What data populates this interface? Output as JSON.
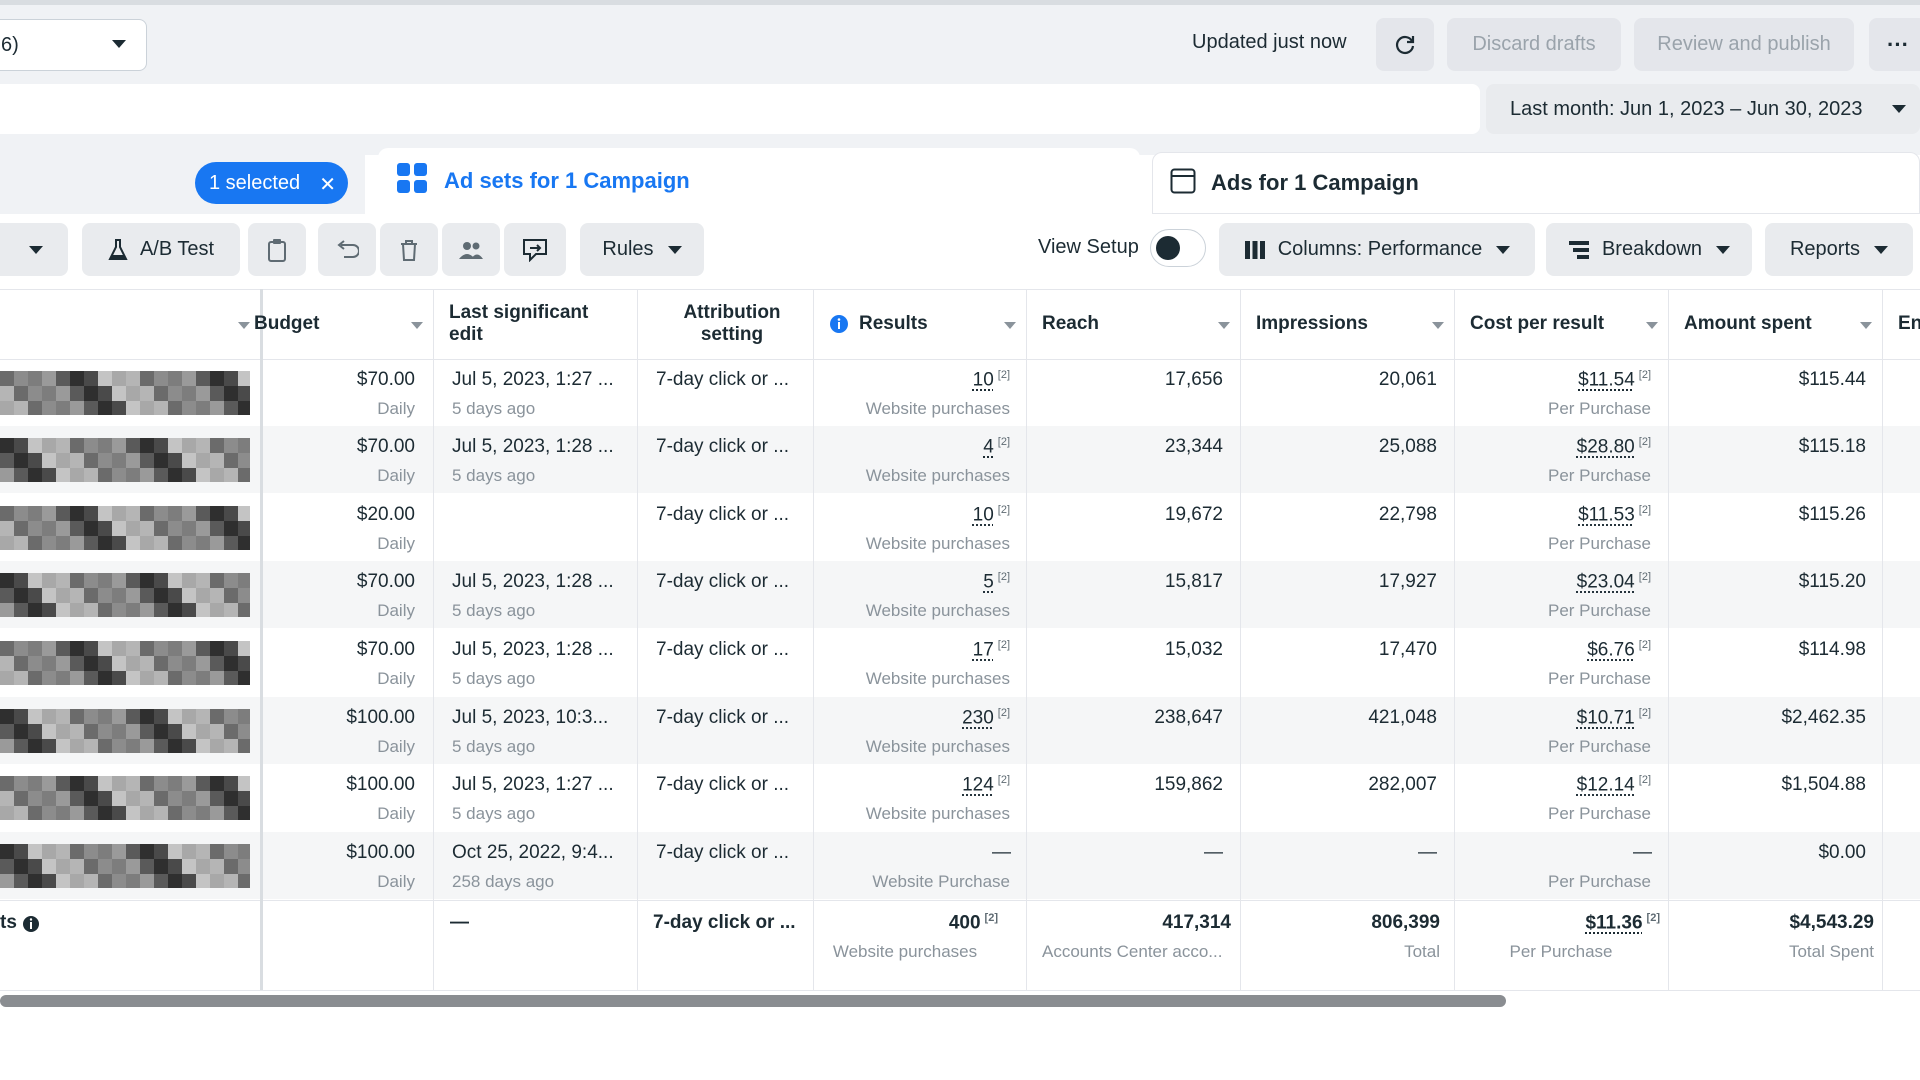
{
  "header": {
    "account_fragment": "6)",
    "updated": "Updated just now",
    "discard": "Discard drafts",
    "review": "Review and publish",
    "more": "···",
    "date_range": "Last month: Jun 1, 2023 – Jun 30, 2023"
  },
  "tabs": {
    "selected_chip": "1 selected",
    "chip_close": "✕",
    "adsets": "Ad sets for 1 Campaign",
    "ads": "Ads for 1 Campaign"
  },
  "toolbar": {
    "ab_test": "A/B Test",
    "rules": "Rules",
    "view_setup": "View Setup",
    "columns": "Columns: Performance",
    "breakdown": "Breakdown",
    "reports": "Reports"
  },
  "columns": {
    "budget": "Budget",
    "last_edit": "Last significant edit",
    "attribution": "Attribution setting",
    "results": "Results",
    "reach": "Reach",
    "impressions": "Impressions",
    "cost_per_result": "Cost per result",
    "amount_spent": "Amount spent",
    "ends": "En"
  },
  "rows": [
    {
      "budget": "$70.00",
      "budget_sub": "Daily",
      "edit": "Jul 5, 2023, 1:27 ...",
      "edit_sub": "5 days ago",
      "attr": "7-day click or ...",
      "results": "10",
      "results_sub": "Website purchases",
      "reach": "17,656",
      "impr": "20,061",
      "cpr": "$11.54",
      "cpr_sub": "Per Purchase",
      "spent": "$115.44"
    },
    {
      "budget": "$70.00",
      "budget_sub": "Daily",
      "edit": "Jul 5, 2023, 1:28 ...",
      "edit_sub": "5 days ago",
      "attr": "7-day click or ...",
      "results": "4",
      "results_sub": "Website purchases",
      "reach": "23,344",
      "impr": "25,088",
      "cpr": "$28.80",
      "cpr_sub": "Per Purchase",
      "spent": "$115.18"
    },
    {
      "budget": "$20.00",
      "budget_sub": "Daily",
      "edit": "",
      "edit_sub": "",
      "attr": "7-day click or ...",
      "results": "10",
      "results_sub": "Website purchases",
      "reach": "19,672",
      "impr": "22,798",
      "cpr": "$11.53",
      "cpr_sub": "Per Purchase",
      "spent": "$115.26"
    },
    {
      "budget": "$70.00",
      "budget_sub": "Daily",
      "edit": "Jul 5, 2023, 1:28 ...",
      "edit_sub": "5 days ago",
      "attr": "7-day click or ...",
      "results": "5",
      "results_sub": "Website purchases",
      "reach": "15,817",
      "impr": "17,927",
      "cpr": "$23.04",
      "cpr_sub": "Per Purchase",
      "spent": "$115.20"
    },
    {
      "budget": "$70.00",
      "budget_sub": "Daily",
      "edit": "Jul 5, 2023, 1:28 ...",
      "edit_sub": "5 days ago",
      "attr": "7-day click or ...",
      "results": "17",
      "results_sub": "Website purchases",
      "reach": "15,032",
      "impr": "17,470",
      "cpr": "$6.76",
      "cpr_sub": "Per Purchase",
      "spent": "$114.98"
    },
    {
      "budget": "$100.00",
      "budget_sub": "Daily",
      "edit": "Jul 5, 2023, 10:3...",
      "edit_sub": "5 days ago",
      "attr": "7-day click or ...",
      "results": "230",
      "results_sub": "Website purchases",
      "reach": "238,647",
      "impr": "421,048",
      "cpr": "$10.71",
      "cpr_sub": "Per Purchase",
      "spent": "$2,462.35"
    },
    {
      "budget": "$100.00",
      "budget_sub": "Daily",
      "edit": "Jul 5, 2023, 1:27 ...",
      "edit_sub": "5 days ago",
      "attr": "7-day click or ...",
      "results": "124",
      "results_sub": "Website purchases",
      "reach": "159,862",
      "impr": "282,007",
      "cpr": "$12.14",
      "cpr_sub": "Per Purchase",
      "spent": "$1,504.88"
    },
    {
      "budget": "$100.00",
      "budget_sub": "Daily",
      "edit": "Oct 25, 2022, 9:4...",
      "edit_sub": "258 days ago",
      "attr": "7-day click or ...",
      "results": "—",
      "results_sub": "Website Purchase",
      "reach": "—",
      "impr": "—",
      "cpr": "—",
      "cpr_sub": "Per Purchase",
      "spent": "$0.00"
    }
  ],
  "totals": {
    "label": "ts",
    "edit": "—",
    "attr": "7-day click or ...",
    "results": "400",
    "results_sub": "Website purchases",
    "reach": "417,314",
    "reach_sub": "Accounts Center acco...",
    "impr": "806,399",
    "impr_sub": "Total",
    "cpr": "$11.36",
    "cpr_sub": "Per Purchase",
    "spent": "$4,543.29",
    "spent_sub": "Total Spent"
  },
  "footnote_marker": "[2]",
  "colors": {
    "accent": "#1877f2",
    "text": "#1c2b33",
    "muted": "#8a939b"
  }
}
